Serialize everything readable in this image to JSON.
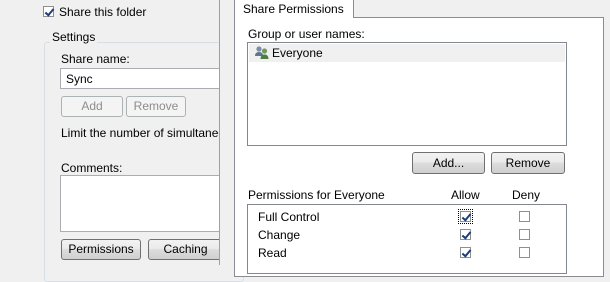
{
  "properties": {
    "share_checkbox_label": "Share this folder",
    "settings_title": "Settings",
    "share_name_label": "Share name:",
    "share_name_value": "Sync",
    "add_label": "Add",
    "remove_label": "Remove",
    "limit_label": "Limit the number of simultaneous",
    "comments_label": "Comments:",
    "permissions_label": "Permissions",
    "caching_label": "Caching"
  },
  "share_permissions": {
    "tab_label": "Share Permissions",
    "group_label": "Group or user names:",
    "users": [
      {
        "name": "Everyone",
        "icon": "users-group-icon"
      }
    ],
    "add_label": "Add...",
    "remove_label": "Remove",
    "permissions_for_label": "Permissions for Everyone",
    "allow_header": "Allow",
    "deny_header": "Deny",
    "permissions": [
      {
        "name": "Full Control",
        "allow": true,
        "deny": false
      },
      {
        "name": "Change",
        "allow": true,
        "deny": false
      },
      {
        "name": "Read",
        "allow": true,
        "deny": false
      }
    ]
  }
}
